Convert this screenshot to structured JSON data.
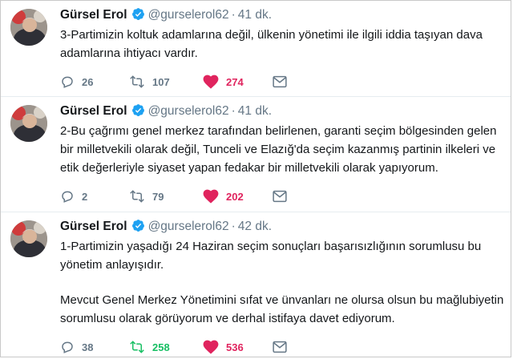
{
  "tweets": [
    {
      "name": "Gürsel Erol",
      "handle": "@gurselerol62",
      "separator": "·",
      "time": "41 dk.",
      "paragraphs": [
        "3-Partimizin koltuk adamlarına değil, ülkenin yönetimi ile ilgili iddia taşıyan dava adamlarına ihtiyacı vardır."
      ],
      "replies": "26",
      "retweets": "107",
      "likes": "274",
      "retweet_active": false
    },
    {
      "name": "Gürsel Erol",
      "handle": "@gurselerol62",
      "separator": "·",
      "time": "41 dk.",
      "paragraphs": [
        "2-Bu çağrımı genel merkez tarafından belirlenen, garanti seçim bölgesinden gelen bir milletvekili olarak değil, Tunceli ve Elazığ'da seçim kazanmış partinin ilkeleri ve etik değerleriyle siyaset yapan fedakar bir milletvekili olarak yapıyorum."
      ],
      "replies": "2",
      "retweets": "79",
      "likes": "202",
      "retweet_active": false
    },
    {
      "name": "Gürsel Erol",
      "handle": "@gurselerol62",
      "separator": "·",
      "time": "42 dk.",
      "paragraphs": [
        "1-Partimizin yaşadığı 24 Haziran seçim sonuçları başarısızlığının sorumlusu bu yönetim anlayışıdır.",
        "Mevcut Genel Merkez Yönetimini sıfat ve ünvanları ne olursa olsun bu mağlubiyetin sorumlusu olarak görüyorum ve derhal istifaya davet ediyorum."
      ],
      "replies": "38",
      "retweets": "258",
      "likes": "536",
      "retweet_active": true
    }
  ],
  "icons": {
    "verified": "verified-badge-icon",
    "reply": "reply-icon",
    "retweet": "retweet-icon",
    "like": "heart-icon",
    "dm": "direct-message-icon"
  },
  "colors": {
    "verified": "#1da1f2",
    "like": "#e0245e",
    "retweet_active": "#17bf63",
    "muted": "#657786"
  }
}
